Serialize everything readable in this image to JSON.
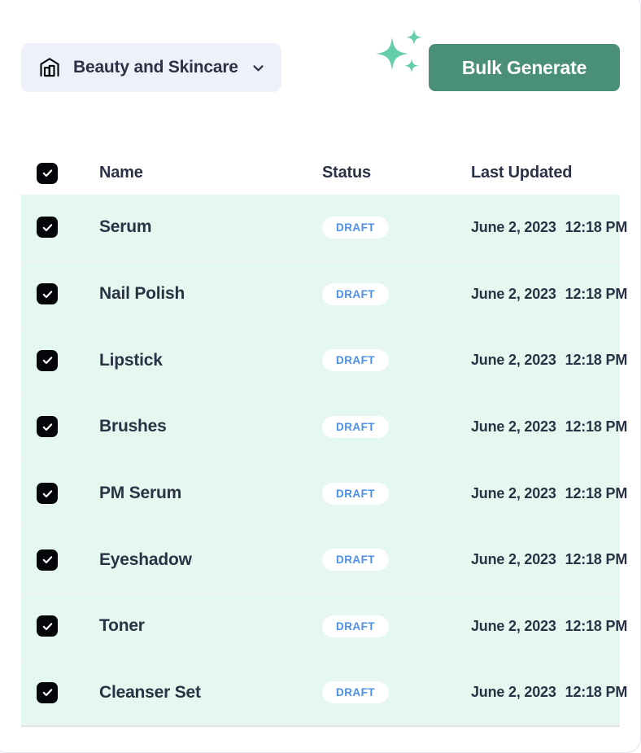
{
  "toolbar": {
    "store_selector": {
      "label": "Beauty and Skincare",
      "icon": "warehouse-icon",
      "chevron": "chevron-down-icon"
    },
    "sparkles_icon": "sparkles-icon",
    "bulk_generate_label": "Bulk Generate"
  },
  "colors": {
    "accent_button": "#4a8f77",
    "sparkle": "#64ceab",
    "row_background": "#e4f8ef",
    "selector_background": "#eef1fa",
    "badge_text": "#4a90e8",
    "text_primary": "#2b3245",
    "checkbox": "#05060a"
  },
  "table": {
    "select_all_checked": true,
    "headers": {
      "name": "Name",
      "status": "Status",
      "last_updated": "Last Updated"
    },
    "rows": [
      {
        "checked": true,
        "name": "Serum",
        "status": "DRAFT",
        "date": "June 2, 2023",
        "time": "12:18 PM"
      },
      {
        "checked": true,
        "name": "Nail Polish",
        "status": "DRAFT",
        "date": "June 2, 2023",
        "time": "12:18 PM"
      },
      {
        "checked": true,
        "name": "Lipstick",
        "status": "DRAFT",
        "date": "June 2, 2023",
        "time": "12:18 PM"
      },
      {
        "checked": true,
        "name": "Brushes",
        "status": "DRAFT",
        "date": "June 2, 2023",
        "time": "12:18 PM"
      },
      {
        "checked": true,
        "name": "PM Serum",
        "status": "DRAFT",
        "date": "June 2, 2023",
        "time": "12:18 PM"
      },
      {
        "checked": true,
        "name": "Eyeshadow",
        "status": "DRAFT",
        "date": "June 2, 2023",
        "time": "12:18 PM"
      },
      {
        "checked": true,
        "name": "Toner",
        "status": "DRAFT",
        "date": "June 2, 2023",
        "time": "12:18 PM"
      },
      {
        "checked": true,
        "name": "Cleanser Set",
        "status": "DRAFT",
        "date": "June 2, 2023",
        "time": "12:18 PM"
      }
    ]
  }
}
